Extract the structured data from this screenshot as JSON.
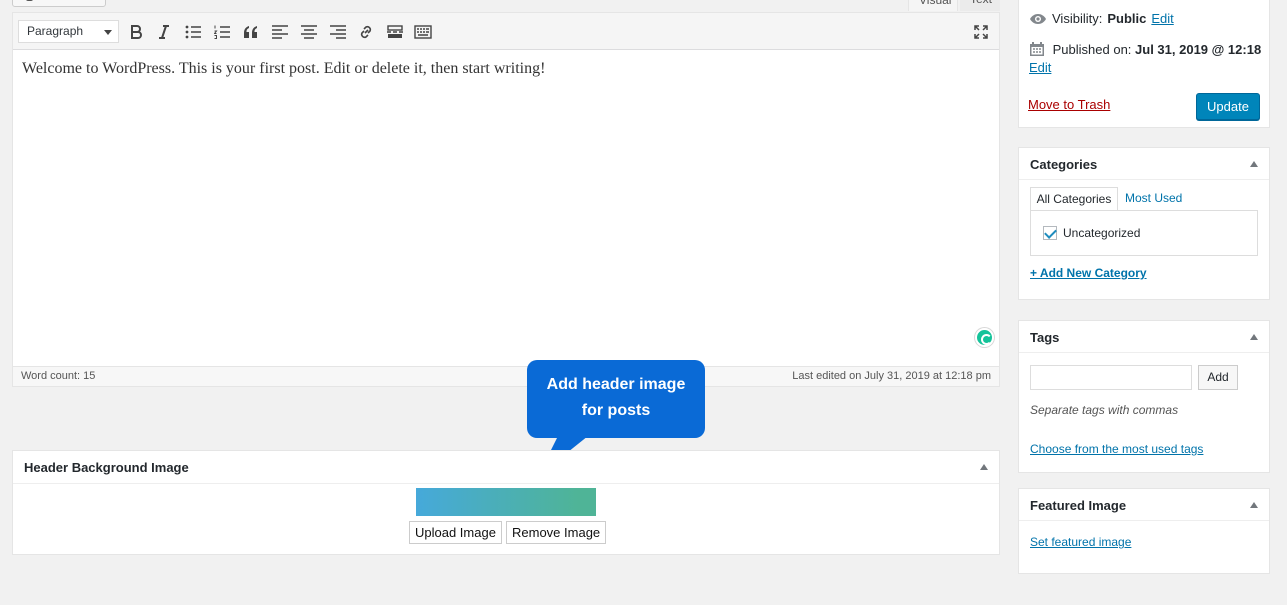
{
  "editor_tabs": {
    "visual": "Visual",
    "text": "Text"
  },
  "toolbar": {
    "format_select": "Paragraph",
    "icons": [
      "bold-icon",
      "italic-icon",
      "bulleted-list-icon",
      "numbered-list-icon",
      "blockquote-icon",
      "align-left-icon",
      "align-center-icon",
      "align-right-icon",
      "link-icon",
      "read-more-icon",
      "toolbar-toggle-icon",
      "fullscreen-icon"
    ]
  },
  "editor": {
    "content": "Welcome to WordPress. This is your first post. Edit or delete it, then start writing!",
    "word_count": "Word count: 15",
    "last_edited": "Last edited on July 31, 2019 at 12:18 pm"
  },
  "callout": {
    "line1": "Add header image",
    "line2": "for posts",
    "color": "#0a6ad6"
  },
  "header_bg": {
    "title": "Header Background Image",
    "upload_label": "Upload Image",
    "remove_label": "Remove Image",
    "gradient": [
      "#46a9da",
      "#4fb497"
    ]
  },
  "publish": {
    "visibility_label": "Visibility:",
    "visibility_value": "Public",
    "visibility_edit": "Edit",
    "published_label": "Published on:",
    "published_value": "Jul 31, 2019 @ 12:18",
    "published_edit": "Edit",
    "trash_label": "Move to Trash",
    "update_label": "Update"
  },
  "categories": {
    "title": "Categories",
    "tab_all": "All Categories",
    "tab_most": "Most Used",
    "items": [
      {
        "label": "Uncategorized",
        "checked": true
      }
    ],
    "add_new": "+ Add New Category"
  },
  "tags": {
    "title": "Tags",
    "add_label": "Add",
    "hint": "Separate tags with commas",
    "choose": "Choose from the most used tags"
  },
  "featured": {
    "title": "Featured Image",
    "set_link": "Set featured image"
  },
  "colors": {
    "accent": "#0073aa",
    "primary_button": "#0085ba",
    "danger": "#a00"
  }
}
